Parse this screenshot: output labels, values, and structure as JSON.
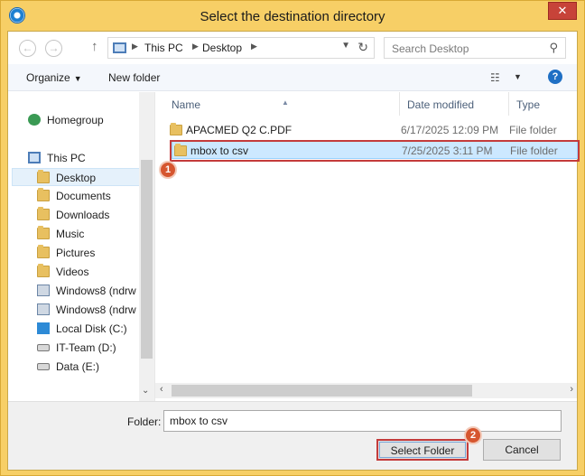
{
  "window": {
    "title": "Select the destination directory",
    "close_glyph": "✕"
  },
  "address": {
    "crumbs": [
      "This PC",
      "Desktop"
    ],
    "search_placeholder": "Search Desktop"
  },
  "toolbar": {
    "organize_label": "Organize",
    "new_folder_label": "New folder"
  },
  "nav": {
    "items": [
      {
        "label": "Homegroup",
        "icon": "homegroup-icon"
      },
      {
        "label": "This PC",
        "icon": "pc-icon"
      },
      {
        "label": "Desktop",
        "icon": "folder-icon",
        "selected": true
      },
      {
        "label": "Documents",
        "icon": "folder-icon"
      },
      {
        "label": "Downloads",
        "icon": "folder-icon"
      },
      {
        "label": "Music",
        "icon": "folder-icon"
      },
      {
        "label": "Pictures",
        "icon": "folder-icon"
      },
      {
        "label": "Videos",
        "icon": "folder-icon"
      },
      {
        "label": "Windows8 (ndrw",
        "icon": "network-drive-icon"
      },
      {
        "label": "Windows8 (ndrw",
        "icon": "network-drive-icon"
      },
      {
        "label": "Local Disk (C:)",
        "icon": "windows-disk-icon"
      },
      {
        "label": "IT-Team (D:)",
        "icon": "drive-icon"
      },
      {
        "label": "Data (E:)",
        "icon": "drive-icon"
      }
    ]
  },
  "list": {
    "columns": {
      "name": "Name",
      "date": "Date modified",
      "type": "Type"
    },
    "rows": [
      {
        "name": "APACMED Q2 C.PDF",
        "date": "6/17/2025 12:09 PM",
        "type": "File folder"
      },
      {
        "name": "mbox to csv",
        "date": "7/25/2025 3:11 PM",
        "type": "File folder",
        "selected": true
      }
    ]
  },
  "badges": {
    "one": "1",
    "two": "2"
  },
  "footer": {
    "folder_label": "Folder:",
    "folder_value": "mbox to csv",
    "select_label": "Select Folder",
    "cancel_label": "Cancel"
  }
}
